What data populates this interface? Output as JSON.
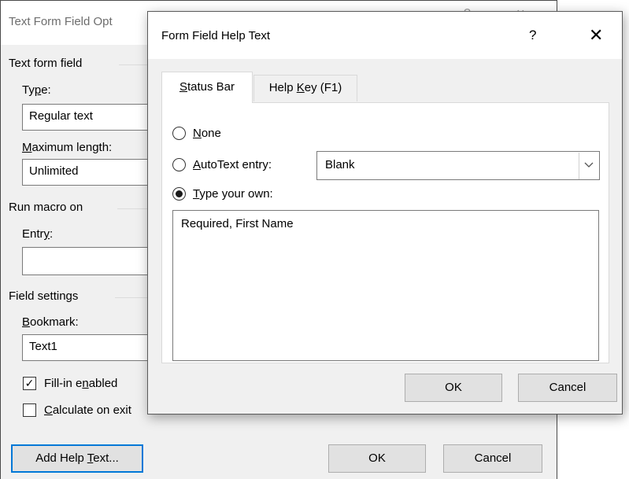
{
  "background_dialog": {
    "title": "Text Form Field Opt",
    "help_glyph": "?",
    "close_glyph": "×",
    "text_form_field": {
      "group_label": "Text form field",
      "type_label": "Type:",
      "type_value": "Regular text",
      "max_length_label": "Maximum length:",
      "max_length_value": "Unlimited"
    },
    "run_macro": {
      "group_label": "Run macro on",
      "entry_label": "Entry:",
      "entry_value": ""
    },
    "field_settings": {
      "group_label": "Field settings",
      "bookmark_label": "Bookmark:",
      "bookmark_value": "Text1",
      "fill_in_label": "Fill-in enabled",
      "fill_in_checked": true,
      "calculate_label": "Calculate on exit",
      "calculate_checked": false
    },
    "buttons": {
      "add_help_text": "Add Help Text...",
      "ok": "OK",
      "cancel": "Cancel"
    }
  },
  "help_dialog": {
    "title": "Form Field Help Text",
    "help_glyph": "?",
    "close_glyph": "✕",
    "tabs": [
      {
        "label": "Status Bar",
        "active": true
      },
      {
        "label": "Help Key (F1)",
        "active": false
      }
    ],
    "options": {
      "none_label": "None",
      "autotext_label": "AutoText entry:",
      "autotext_value": "Blank",
      "type_own_label": "Type your own:",
      "selected": "type_your_own"
    },
    "custom_text": "Required, First Name",
    "buttons": {
      "ok": "OK",
      "cancel": "Cancel"
    }
  },
  "colors": {
    "dialog_bg": "#f0f0f0",
    "default_button_border": "#0078d7"
  }
}
